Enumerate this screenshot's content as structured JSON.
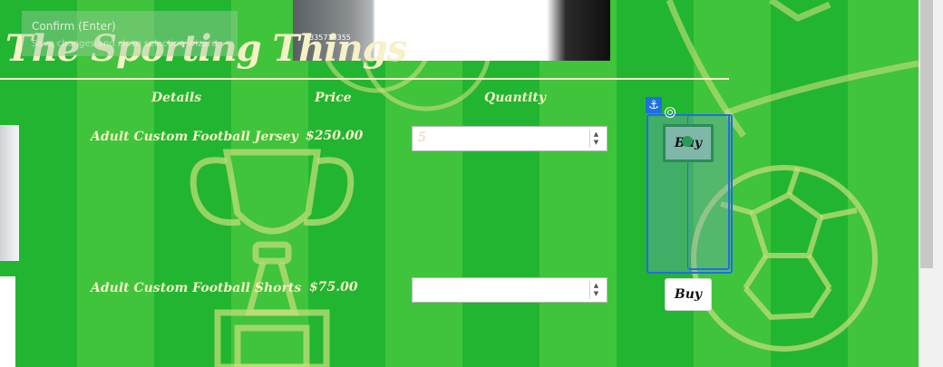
{
  "tooltip": {
    "title": "Confirm (Enter)",
    "description": "Save changes and close selection wizard."
  },
  "site": {
    "title": "The Sporting Things"
  },
  "top_image": {
    "caption": "1335716355"
  },
  "table": {
    "headers": {
      "details": "Details",
      "price": "Price",
      "quantity": "Quantity"
    },
    "rows": [
      {
        "name": "Adult Custom Football Jersey",
        "price": "$250.00",
        "quantity": "5",
        "buy_label": "Buy"
      },
      {
        "name": "Adult Custom Football Shorts",
        "price": "$75.00",
        "quantity": "",
        "buy_label": "Buy"
      }
    ]
  },
  "icons": {
    "anchor": "⚓",
    "spin_up": "▲",
    "spin_down": "▼"
  },
  "colors": {
    "accent_text": "#f6f1c6",
    "selection": "#1f6fe0",
    "stripe_dark": "#22b532",
    "stripe_light": "#3fc43c"
  }
}
